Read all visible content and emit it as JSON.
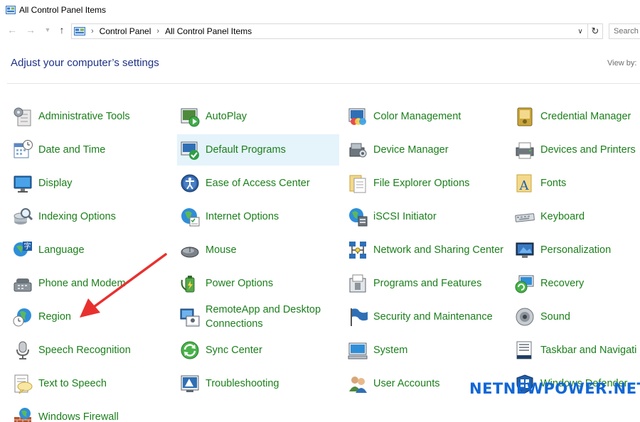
{
  "window": {
    "title": "All Control Panel Items"
  },
  "address_bar": {
    "breadcrumbs": [
      "Control Panel",
      "All Control Panel Items"
    ],
    "search_placeholder": "Search Control Panel"
  },
  "header": {
    "title": "Adjust your computer’s settings",
    "view_by_label": "View by:"
  },
  "columns": [
    [
      {
        "label": "Administrative Tools",
        "icon": "administrative-tools-icon"
      },
      {
        "label": "Date and Time",
        "icon": "date-and-time-icon"
      },
      {
        "label": "Display",
        "icon": "display-icon"
      },
      {
        "label": "Indexing Options",
        "icon": "indexing-options-icon"
      },
      {
        "label": "Language",
        "icon": "language-icon"
      },
      {
        "label": "Phone and Modem",
        "icon": "phone-and-modem-icon"
      },
      {
        "label": "Region",
        "icon": "region-icon"
      },
      {
        "label": "Speech Recognition",
        "icon": "speech-recognition-icon"
      },
      {
        "label": "Text to Speech",
        "icon": "text-to-speech-icon"
      },
      {
        "label": "Windows Firewall",
        "icon": "windows-firewall-icon"
      }
    ],
    [
      {
        "label": "AutoPlay",
        "icon": "autoplay-icon"
      },
      {
        "label": "Default Programs",
        "icon": "default-programs-icon",
        "highlighted": true
      },
      {
        "label": "Ease of Access Center",
        "icon": "ease-of-access-icon"
      },
      {
        "label": "Internet Options",
        "icon": "internet-options-icon"
      },
      {
        "label": "Mouse",
        "icon": "mouse-icon"
      },
      {
        "label": "Power Options",
        "icon": "power-options-icon"
      },
      {
        "label": "RemoteApp and Desktop Connections",
        "icon": "remoteapp-icon"
      },
      {
        "label": "Sync Center",
        "icon": "sync-center-icon"
      },
      {
        "label": "Troubleshooting",
        "icon": "troubleshooting-icon"
      }
    ],
    [
      {
        "label": "Color Management",
        "icon": "color-management-icon"
      },
      {
        "label": "Device Manager",
        "icon": "device-manager-icon"
      },
      {
        "label": "File Explorer Options",
        "icon": "file-explorer-options-icon"
      },
      {
        "label": "iSCSI Initiator",
        "icon": "iscsi-initiator-icon"
      },
      {
        "label": "Network and Sharing Center",
        "icon": "network-sharing-icon"
      },
      {
        "label": "Programs and Features",
        "icon": "programs-features-icon"
      },
      {
        "label": "Security and Maintenance",
        "icon": "security-maintenance-icon"
      },
      {
        "label": "System",
        "icon": "system-icon"
      },
      {
        "label": "User Accounts",
        "icon": "user-accounts-icon"
      }
    ],
    [
      {
        "label": "Credential Manager",
        "icon": "credential-manager-icon"
      },
      {
        "label": "Devices and Printers",
        "icon": "devices-printers-icon"
      },
      {
        "label": "Fonts",
        "icon": "fonts-icon"
      },
      {
        "label": "Keyboard",
        "icon": "keyboard-icon"
      },
      {
        "label": "Personalization",
        "icon": "personalization-icon"
      },
      {
        "label": "Recovery",
        "icon": "recovery-icon"
      },
      {
        "label": "Sound",
        "icon": "sound-icon"
      },
      {
        "label": "Taskbar and Navigation",
        "icon": "taskbar-navigation-icon"
      },
      {
        "label": "Windows Defender",
        "icon": "windows-defender-icon"
      }
    ]
  ],
  "watermark": {
    "text": "NETNEWPOWER.NET"
  },
  "colors": {
    "link_green": "#1b7f1b",
    "title_blue": "#1e3287",
    "highlight": "#e5f3fb",
    "arrow_red": "#e8312f",
    "watermark_blue": "#1167d6"
  }
}
